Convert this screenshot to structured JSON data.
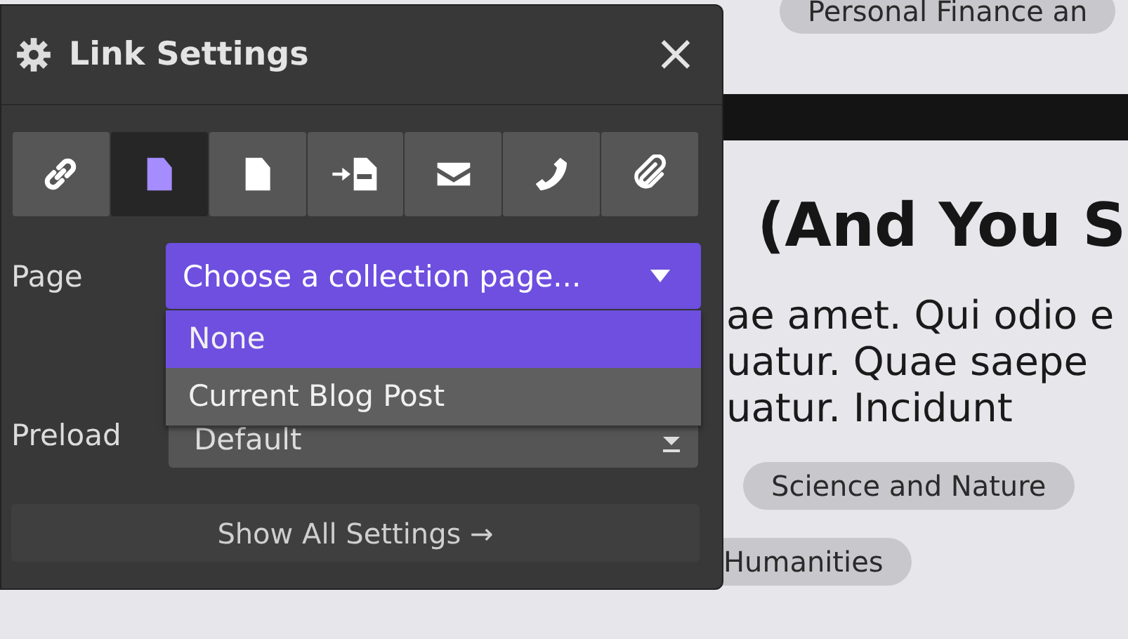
{
  "background_page": {
    "top_tag": "Personal Finance an",
    "heading": "(And You S",
    "paragraph_lines": [
      "ae amet. Qui odio e",
      "uatur. Quae saepe",
      "uatur. Incidunt"
    ],
    "tags": [
      "Science and Nature",
      "Humanities"
    ]
  },
  "panel": {
    "title": "Link Settings",
    "close": "×",
    "tabs": [
      {
        "selected": false
      },
      {
        "selected": true
      },
      {
        "selected": false
      },
      {
        "selected": false
      },
      {
        "selected": false
      },
      {
        "selected": false
      },
      {
        "selected": false
      }
    ],
    "page_field": {
      "label": "Page",
      "placeholder": "Choose a collection page...",
      "expanded": true,
      "options": [
        {
          "label": "None",
          "selected": true
        },
        {
          "label": "Current Blog Post",
          "selected": false
        }
      ]
    },
    "preload_field": {
      "label": "Preload",
      "value": "Default"
    },
    "show_all": "Show All Settings →"
  }
}
